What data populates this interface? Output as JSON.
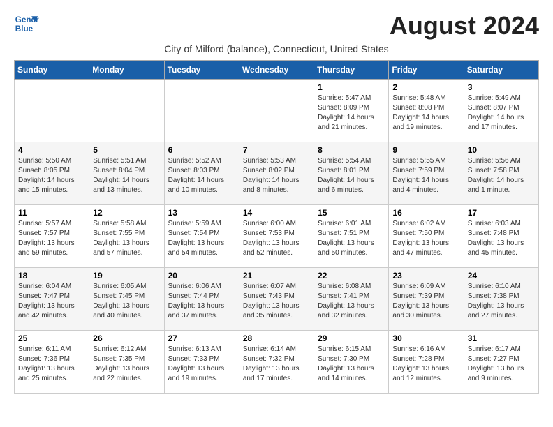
{
  "header": {
    "logo_line1": "General",
    "logo_line2": "Blue",
    "month_title": "August 2024",
    "subtitle": "City of Milford (balance), Connecticut, United States"
  },
  "days_of_week": [
    "Sunday",
    "Monday",
    "Tuesday",
    "Wednesday",
    "Thursday",
    "Friday",
    "Saturday"
  ],
  "weeks": [
    [
      {
        "day": "",
        "info": ""
      },
      {
        "day": "",
        "info": ""
      },
      {
        "day": "",
        "info": ""
      },
      {
        "day": "",
        "info": ""
      },
      {
        "day": "1",
        "info": "Sunrise: 5:47 AM\nSunset: 8:09 PM\nDaylight: 14 hours\nand 21 minutes."
      },
      {
        "day": "2",
        "info": "Sunrise: 5:48 AM\nSunset: 8:08 PM\nDaylight: 14 hours\nand 19 minutes."
      },
      {
        "day": "3",
        "info": "Sunrise: 5:49 AM\nSunset: 8:07 PM\nDaylight: 14 hours\nand 17 minutes."
      }
    ],
    [
      {
        "day": "4",
        "info": "Sunrise: 5:50 AM\nSunset: 8:05 PM\nDaylight: 14 hours\nand 15 minutes."
      },
      {
        "day": "5",
        "info": "Sunrise: 5:51 AM\nSunset: 8:04 PM\nDaylight: 14 hours\nand 13 minutes."
      },
      {
        "day": "6",
        "info": "Sunrise: 5:52 AM\nSunset: 8:03 PM\nDaylight: 14 hours\nand 10 minutes."
      },
      {
        "day": "7",
        "info": "Sunrise: 5:53 AM\nSunset: 8:02 PM\nDaylight: 14 hours\nand 8 minutes."
      },
      {
        "day": "8",
        "info": "Sunrise: 5:54 AM\nSunset: 8:01 PM\nDaylight: 14 hours\nand 6 minutes."
      },
      {
        "day": "9",
        "info": "Sunrise: 5:55 AM\nSunset: 7:59 PM\nDaylight: 14 hours\nand 4 minutes."
      },
      {
        "day": "10",
        "info": "Sunrise: 5:56 AM\nSunset: 7:58 PM\nDaylight: 14 hours\nand 1 minute."
      }
    ],
    [
      {
        "day": "11",
        "info": "Sunrise: 5:57 AM\nSunset: 7:57 PM\nDaylight: 13 hours\nand 59 minutes."
      },
      {
        "day": "12",
        "info": "Sunrise: 5:58 AM\nSunset: 7:55 PM\nDaylight: 13 hours\nand 57 minutes."
      },
      {
        "day": "13",
        "info": "Sunrise: 5:59 AM\nSunset: 7:54 PM\nDaylight: 13 hours\nand 54 minutes."
      },
      {
        "day": "14",
        "info": "Sunrise: 6:00 AM\nSunset: 7:53 PM\nDaylight: 13 hours\nand 52 minutes."
      },
      {
        "day": "15",
        "info": "Sunrise: 6:01 AM\nSunset: 7:51 PM\nDaylight: 13 hours\nand 50 minutes."
      },
      {
        "day": "16",
        "info": "Sunrise: 6:02 AM\nSunset: 7:50 PM\nDaylight: 13 hours\nand 47 minutes."
      },
      {
        "day": "17",
        "info": "Sunrise: 6:03 AM\nSunset: 7:48 PM\nDaylight: 13 hours\nand 45 minutes."
      }
    ],
    [
      {
        "day": "18",
        "info": "Sunrise: 6:04 AM\nSunset: 7:47 PM\nDaylight: 13 hours\nand 42 minutes."
      },
      {
        "day": "19",
        "info": "Sunrise: 6:05 AM\nSunset: 7:45 PM\nDaylight: 13 hours\nand 40 minutes."
      },
      {
        "day": "20",
        "info": "Sunrise: 6:06 AM\nSunset: 7:44 PM\nDaylight: 13 hours\nand 37 minutes."
      },
      {
        "day": "21",
        "info": "Sunrise: 6:07 AM\nSunset: 7:43 PM\nDaylight: 13 hours\nand 35 minutes."
      },
      {
        "day": "22",
        "info": "Sunrise: 6:08 AM\nSunset: 7:41 PM\nDaylight: 13 hours\nand 32 minutes."
      },
      {
        "day": "23",
        "info": "Sunrise: 6:09 AM\nSunset: 7:39 PM\nDaylight: 13 hours\nand 30 minutes."
      },
      {
        "day": "24",
        "info": "Sunrise: 6:10 AM\nSunset: 7:38 PM\nDaylight: 13 hours\nand 27 minutes."
      }
    ],
    [
      {
        "day": "25",
        "info": "Sunrise: 6:11 AM\nSunset: 7:36 PM\nDaylight: 13 hours\nand 25 minutes."
      },
      {
        "day": "26",
        "info": "Sunrise: 6:12 AM\nSunset: 7:35 PM\nDaylight: 13 hours\nand 22 minutes."
      },
      {
        "day": "27",
        "info": "Sunrise: 6:13 AM\nSunset: 7:33 PM\nDaylight: 13 hours\nand 19 minutes."
      },
      {
        "day": "28",
        "info": "Sunrise: 6:14 AM\nSunset: 7:32 PM\nDaylight: 13 hours\nand 17 minutes."
      },
      {
        "day": "29",
        "info": "Sunrise: 6:15 AM\nSunset: 7:30 PM\nDaylight: 13 hours\nand 14 minutes."
      },
      {
        "day": "30",
        "info": "Sunrise: 6:16 AM\nSunset: 7:28 PM\nDaylight: 13 hours\nand 12 minutes."
      },
      {
        "day": "31",
        "info": "Sunrise: 6:17 AM\nSunset: 7:27 PM\nDaylight: 13 hours\nand 9 minutes."
      }
    ]
  ]
}
